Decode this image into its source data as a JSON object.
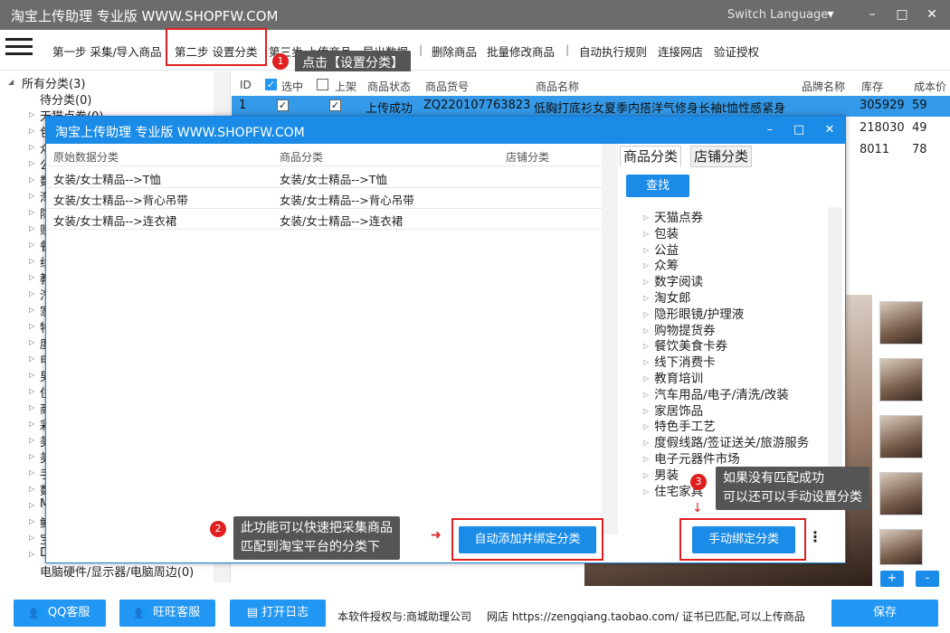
{
  "app": {
    "title": "淘宝上传助理 专业版 WWW.SHOPFW.COM",
    "switch_language": "Switch Language"
  },
  "menu": [
    "第一步 采集/导入商品",
    "第二步 设置分类",
    "第三步 上传商品",
    "导出数据",
    "|",
    "删除商品",
    "批量修改商品",
    "|",
    "自动执行规则",
    "连接网店",
    "验证授权"
  ],
  "tips": {
    "step1_num": "1",
    "step1": "点击【设置分类】",
    "step2_num": "2",
    "step2_l1": "此功能可以快速把采集商品",
    "step2_l2": "匹配到淘宝平台的分类下",
    "step3_num": "3",
    "step3_l1": "如果没有匹配成功",
    "step3_l2": "可以还可以手动设置分类"
  },
  "tree": {
    "root": "所有分类(3)",
    "items": [
      "待分类(0)",
      "天猫点券(0)",
      "包",
      "众",
      "公",
      "数",
      "淘",
      "隐",
      "购",
      "餐",
      "线",
      "教",
      "汽",
      "家",
      "特",
      "度",
      "电",
      "男",
      "住",
      "商",
      "彩",
      "美",
      "美",
      "手",
      "数",
      "M",
      "鲜",
      "宝",
      "D"
    ],
    "last": "电脑硬件/显示器/电脑周边(0)"
  },
  "grid": {
    "headers": [
      "ID",
      "选中",
      "上架",
      "商品状态",
      "商品货号",
      "商品名称",
      "品牌名称",
      "库存",
      "成本价"
    ],
    "rows": [
      {
        "id": "1",
        "status": "上传成功",
        "sku": "ZQ220107763823",
        "name": "低胸打底衫女夏季内搭洋气修身长袖t恤性感紧身",
        "stock": "305929",
        "cost": "59"
      },
      {
        "id": "",
        "status": "",
        "sku": "",
        "name": "",
        "stock": "218030",
        "cost": "49"
      },
      {
        "id": "",
        "status": "",
        "sku": "",
        "name": "",
        "stock": "8011",
        "cost": "78"
      }
    ]
  },
  "dialog": {
    "title": "淘宝上传助理 专业版 WWW.SHOPFW.COM",
    "headers": [
      "原始数据分类",
      "商品分类",
      "店铺分类"
    ],
    "rows": [
      [
        "女装/女士精品-->T恤",
        "女装/女士精品-->T恤"
      ],
      [
        "女装/女士精品-->背心吊带",
        "女装/女士精品-->背心吊带"
      ],
      [
        "女装/女士精品-->连衣裙",
        "女装/女士精品-->连衣裙"
      ]
    ],
    "tabs": [
      "商品分类",
      "店铺分类"
    ],
    "search_btn": "查找",
    "categories": [
      "天猫点券",
      "包装",
      "公益",
      "众筹",
      "数字阅读",
      "淘女郎",
      "隐形眼镜/护理液",
      "购物提货券",
      "餐饮美食卡券",
      "线下消费卡",
      "教育培训",
      "汽车用品/电子/清洗/改装",
      "家居饰品",
      "特色手工艺",
      "度假线路/签证送关/旅游服务",
      "电子元器件市场",
      "男装",
      "住宅家具"
    ],
    "auto_btn": "自动添加并绑定分类",
    "manual_btn": "手动绑定分类"
  },
  "bottom": {
    "qq": "QQ客服",
    "ww": "旺旺客服",
    "log": "打开日志",
    "license": "本软件授权与:商城助理公司",
    "shop": "网店 https://zengqiang.taobao.com/ 证书已匹配,可以上传商品",
    "save": "保存",
    "plus": "+",
    "minus": "-"
  }
}
